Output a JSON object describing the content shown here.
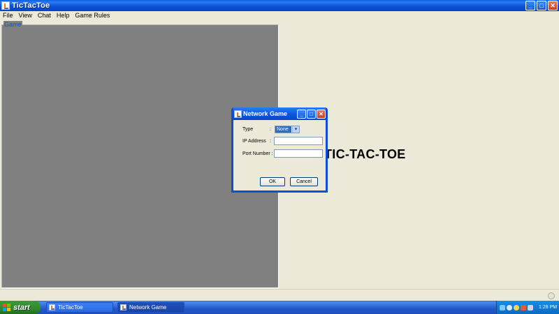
{
  "window": {
    "title": "TicTacToe",
    "buttons": {
      "minimize": "_",
      "maximize": "□",
      "close": "✕"
    }
  },
  "menu": [
    "File",
    "View",
    "Chat",
    "Help",
    "Game Rules"
  ],
  "game_panel": {
    "group_label": "Game"
  },
  "main": {
    "title": "TIC-TAC-TOE"
  },
  "dialog": {
    "title": "Network Game",
    "buttons": {
      "minimize": "_",
      "maximize": "□",
      "close": "✕"
    },
    "type_label": "Type",
    "type_value": "None",
    "ip_label": "IP Address",
    "ip_value": "",
    "port_label": "Port Number :",
    "port_value": "",
    "colon": ":",
    "ok_label": "OK",
    "cancel_label": "Cancel"
  },
  "taskbar": {
    "start_label": "start",
    "tasks": [
      "TicTacToe",
      "Network Game"
    ],
    "clock": "1:28 PM"
  },
  "colors": {
    "title_bar": "#0a54d6",
    "game_area": "#808080",
    "panel_bg": "#ece9d8",
    "start_green": "#2f8a2f",
    "selection": "#316ac5"
  }
}
